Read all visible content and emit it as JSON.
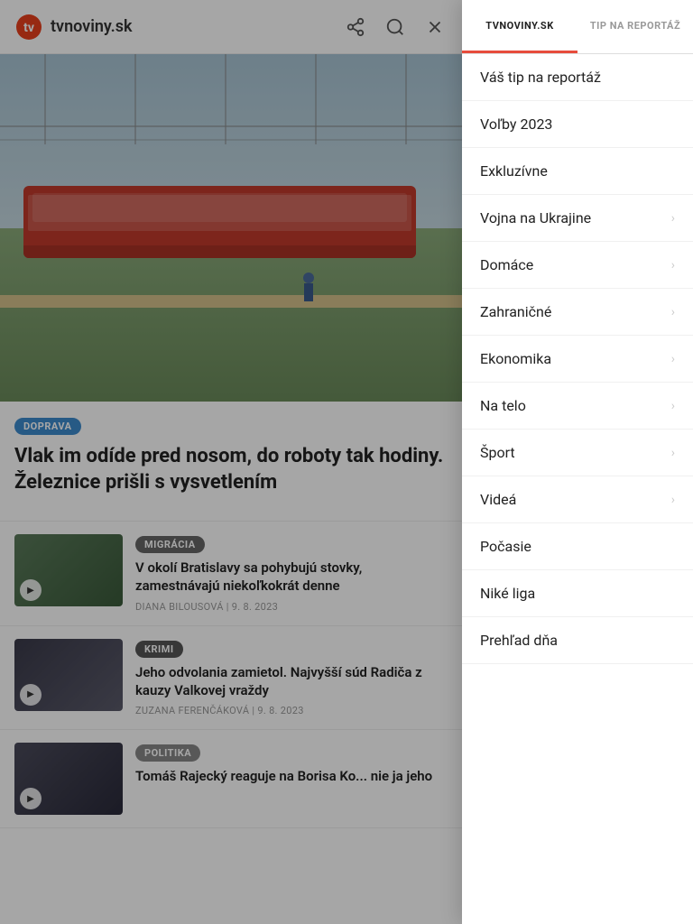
{
  "header": {
    "logo_text": "tvnoviny.sk",
    "icon_share": "share-icon",
    "icon_search": "search-icon",
    "icon_close": "close-icon"
  },
  "hero": {
    "tag": "DOPRAVA",
    "tag_class": "tag-doprava",
    "title": "Vlak im odíde pred nosom, do roboty tak hodiny. Železnice prišli s vysvetlením"
  },
  "articles": [
    {
      "tag": "MIGRÁCIA",
      "tag_class": "tag-migracia",
      "thumb_class": "thumb-bg-migracia",
      "text": "V okolí Bratislavy sa pohybujú stovky, zamestnávajú niekoľkokrát denne",
      "byline": "DIANA BILOUSOVÁ | 9. 8. 2023"
    },
    {
      "tag": "KRIMI",
      "tag_class": "tag-krimi",
      "thumb_class": "thumb-bg-krimi",
      "text": "Jeho odvolania zamietol. Najvyšší súd Radiča z kauzy Valkovej vraždy",
      "byline": "ZUZANA FERENČÁKOVÁ | 9. 8. 2023"
    },
    {
      "tag": "POLITIKA",
      "tag_class": "tag-politika",
      "thumb_class": "thumb-bg-politika",
      "text": "Tomáš Rajecký reaguje na Borisa Ko... nie ja jeho",
      "byline": ""
    }
  ],
  "panel": {
    "tab_tvnoviny": "TVNOVINY.SK",
    "tab_tip": "TIP NA REPORTÁŽ",
    "nav_items": [
      {
        "label": "Váš tip na reportáž",
        "has_arrow": false
      },
      {
        "label": "Voľby 2023",
        "has_arrow": false
      },
      {
        "label": "Exkluzívne",
        "has_arrow": false
      },
      {
        "label": "Vojna na Ukrajine",
        "has_arrow": true
      },
      {
        "label": "Domáce",
        "has_arrow": true
      },
      {
        "label": "Zahraničné",
        "has_arrow": true
      },
      {
        "label": "Ekonomika",
        "has_arrow": true
      },
      {
        "label": "Na telo",
        "has_arrow": true
      },
      {
        "label": "Šport",
        "has_arrow": true
      },
      {
        "label": "Videá",
        "has_arrow": true
      },
      {
        "label": "Počasie",
        "has_arrow": false
      },
      {
        "label": "Niké liga",
        "has_arrow": false
      },
      {
        "label": "Prehľad dňa",
        "has_arrow": false
      }
    ]
  }
}
